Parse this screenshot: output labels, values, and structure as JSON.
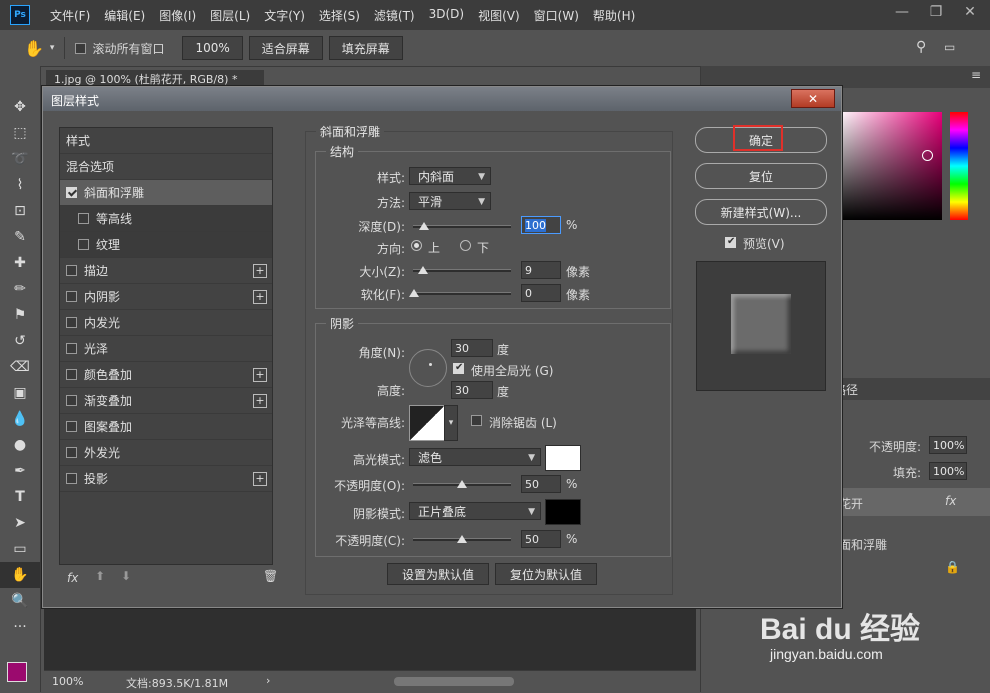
{
  "app": {
    "logo": "Ps"
  },
  "menu": [
    "文件(F)",
    "编辑(E)",
    "图像(I)",
    "图层(L)",
    "文字(Y)",
    "选择(S)",
    "滤镜(T)",
    "3D(D)",
    "视图(V)",
    "窗口(W)",
    "帮助(H)"
  ],
  "options_bar": {
    "scroll_all_label": "滚动所有窗口",
    "zoom_value": "100%",
    "fit_screen": "适合屏幕",
    "fill_screen": "填充屏幕"
  },
  "document_tab": {
    "label": "1.jpg @ 100% (杜鹃花开, RGB/8) *"
  },
  "status_bar": {
    "zoom": "100%",
    "doc_info": "文档:893.5K/1.81M"
  },
  "right_panel": {
    "tab_partial": "路径",
    "opacity_label": "不透明度:",
    "opacity_value": "100%",
    "fill_label": "填充:",
    "fill_value": "100%",
    "layer_name": "花开",
    "effect_name": "面和浮雕",
    "fx_label": "fx"
  },
  "dialog": {
    "title": "图层样式",
    "close_label": "✕",
    "styles_header": "样式",
    "blend_options": "混合选项",
    "style_items": [
      {
        "label": "斜面和浮雕",
        "checked": true,
        "selected": true,
        "sub": false,
        "plus": false
      },
      {
        "label": "等高线",
        "checked": false,
        "selected": false,
        "sub": true,
        "plus": false
      },
      {
        "label": "纹理",
        "checked": false,
        "selected": false,
        "sub": true,
        "plus": false
      },
      {
        "label": "描边",
        "checked": false,
        "selected": false,
        "sub": false,
        "plus": true
      },
      {
        "label": "内阴影",
        "checked": false,
        "selected": false,
        "sub": false,
        "plus": true
      },
      {
        "label": "内发光",
        "checked": false,
        "selected": false,
        "sub": false,
        "plus": false
      },
      {
        "label": "光泽",
        "checked": false,
        "selected": false,
        "sub": false,
        "plus": false
      },
      {
        "label": "颜色叠加",
        "checked": false,
        "selected": false,
        "sub": false,
        "plus": true
      },
      {
        "label": "渐变叠加",
        "checked": false,
        "selected": false,
        "sub": false,
        "plus": true
      },
      {
        "label": "图案叠加",
        "checked": false,
        "selected": false,
        "sub": false,
        "plus": false
      },
      {
        "label": "外发光",
        "checked": false,
        "selected": false,
        "sub": false,
        "plus": false
      },
      {
        "label": "投影",
        "checked": false,
        "selected": false,
        "sub": false,
        "plus": true
      }
    ],
    "fx_label": "fx",
    "bevel": {
      "section_title": "斜面和浮雕",
      "structure_title": "结构",
      "style_label": "样式:",
      "style_value": "内斜面",
      "technique_label": "方法:",
      "technique_value": "平滑",
      "depth_label": "深度(D):",
      "depth_value": "100",
      "depth_unit": "%",
      "direction_label": "方向:",
      "direction_up": "上",
      "direction_down": "下",
      "size_label": "大小(Z):",
      "size_value": "9",
      "size_unit": "像素",
      "soften_label": "软化(F):",
      "soften_value": "0",
      "soften_unit": "像素"
    },
    "shading": {
      "title": "阴影",
      "angle_label": "角度(N):",
      "angle_value": "30",
      "angle_unit": "度",
      "global_light_label": "使用全局光 (G)",
      "altitude_label": "高度:",
      "altitude_value": "30",
      "altitude_unit": "度",
      "gloss_contour_label": "光泽等高线:",
      "anti_alias_label": "消除锯齿 (L)",
      "highlight_mode_label": "高光模式:",
      "highlight_mode_value": "滤色",
      "highlight_color": "#ffffff",
      "highlight_opacity_label": "不透明度(O):",
      "highlight_opacity_value": "50",
      "highlight_opacity_unit": "%",
      "shadow_mode_label": "阴影模式:",
      "shadow_mode_value": "正片叠底",
      "shadow_color": "#000000",
      "shadow_opacity_label": "不透明度(C):",
      "shadow_opacity_value": "50",
      "shadow_opacity_unit": "%"
    },
    "make_default": "设置为默认值",
    "reset_default": "复位为默认值",
    "ok": "确定",
    "reset": "复位",
    "new_style": "新建样式(W)...",
    "preview_label": "预览(V)"
  },
  "watermark": {
    "brand": "Bai du 经验",
    "url": "jingyan.baidu.com"
  },
  "colors": {
    "highlight_frame": "#e0302a",
    "foreground": "#9b0a6e"
  }
}
